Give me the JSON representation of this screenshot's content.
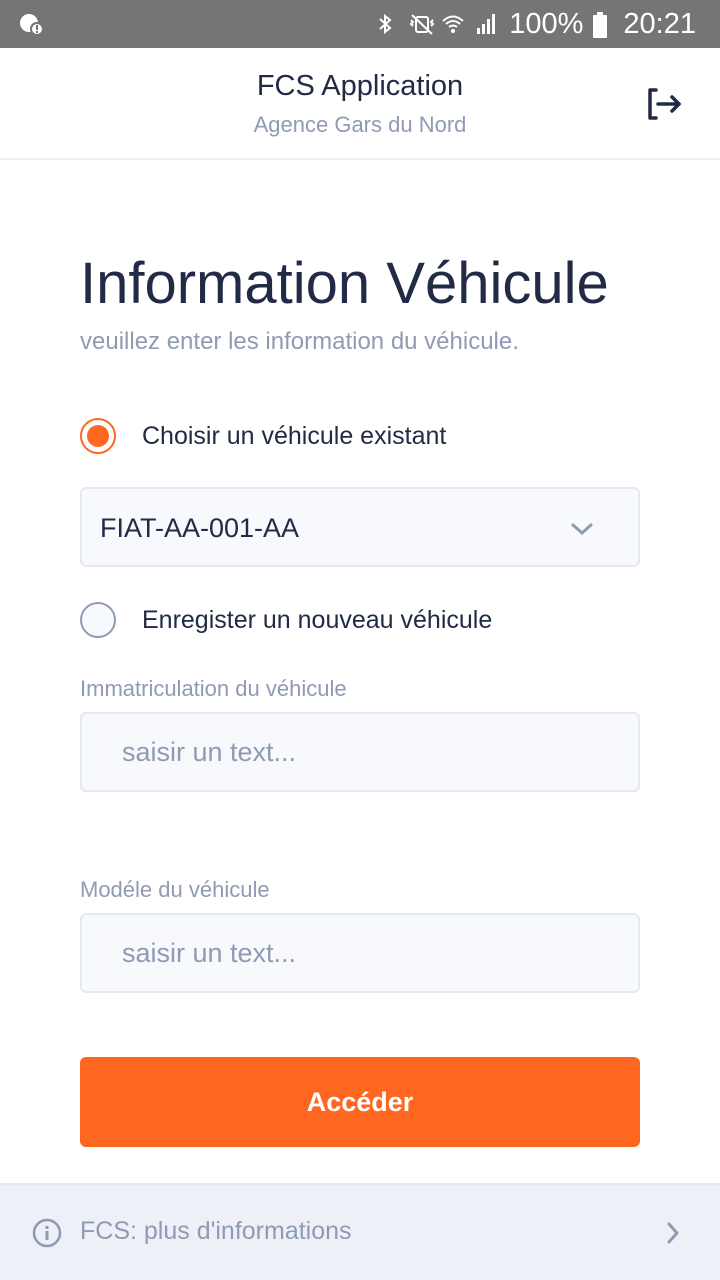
{
  "status_bar": {
    "battery": "100%",
    "time": "20:21",
    "icons": [
      "notification-icon",
      "bluetooth-icon",
      "mute-vibrate-icon",
      "wifi-icon",
      "signal-icon",
      "battery-icon"
    ]
  },
  "header": {
    "title": "FCS Application",
    "subtitle": "Agence Gars du Nord",
    "logout_icon": "logout-icon"
  },
  "main": {
    "title": "Information Véhicule",
    "subtitle": "veuillez enter les information du véhicule.",
    "options": [
      {
        "label": "Choisir un véhicule existant",
        "checked": true
      },
      {
        "label": "Enregister un nouveau véhicule",
        "checked": false
      }
    ],
    "vehicle_select": {
      "value": "FIAT-AA-001-AA"
    },
    "fields": [
      {
        "label": "Immatriculation du véhicule",
        "value": "",
        "placeholder": "saisir un text..."
      },
      {
        "label": "Modéle du véhicule",
        "value": "",
        "placeholder": "saisir un text..."
      }
    ],
    "submit_label": "Accéder"
  },
  "footer": {
    "text": "FCS: plus d'informations"
  },
  "colors": {
    "accent": "#ff6720",
    "text_primary": "#222b45",
    "text_hint": "#8f9bb3",
    "input_bg": "#f7f9fc",
    "status_bar": "#757575"
  }
}
